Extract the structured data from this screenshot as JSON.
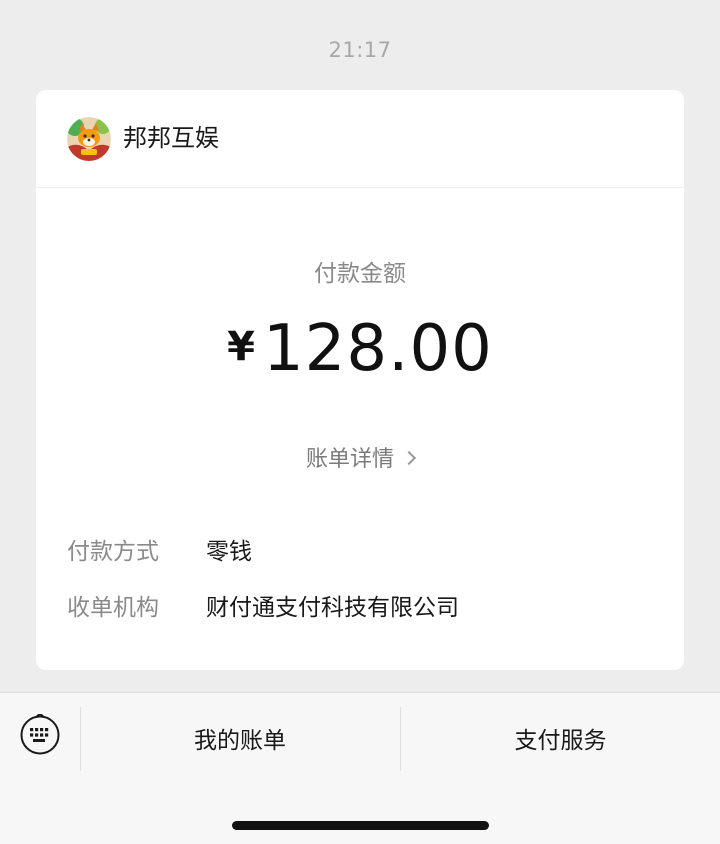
{
  "timestamp": "21:17",
  "merchant": {
    "name": "邦邦互娱",
    "avatar_icon": "cartoon-fox-avatar-icon"
  },
  "payment": {
    "amount_label": "付款金额",
    "currency_symbol": "¥",
    "amount": "128.00",
    "detail_link_label": "账单详情"
  },
  "details": [
    {
      "key": "付款方式",
      "value": "零钱"
    },
    {
      "key": "收单机构",
      "value": "财付通支付科技有限公司"
    }
  ],
  "bottom_menu": {
    "keyboard_icon": "keyboard-icon",
    "items": [
      {
        "label": "我的账单"
      },
      {
        "label": "支付服务"
      }
    ]
  },
  "colors": {
    "page_background": "#ededed",
    "card_background": "#ffffff",
    "secondary_text": "#8a8a8a",
    "primary_text": "#191919"
  }
}
